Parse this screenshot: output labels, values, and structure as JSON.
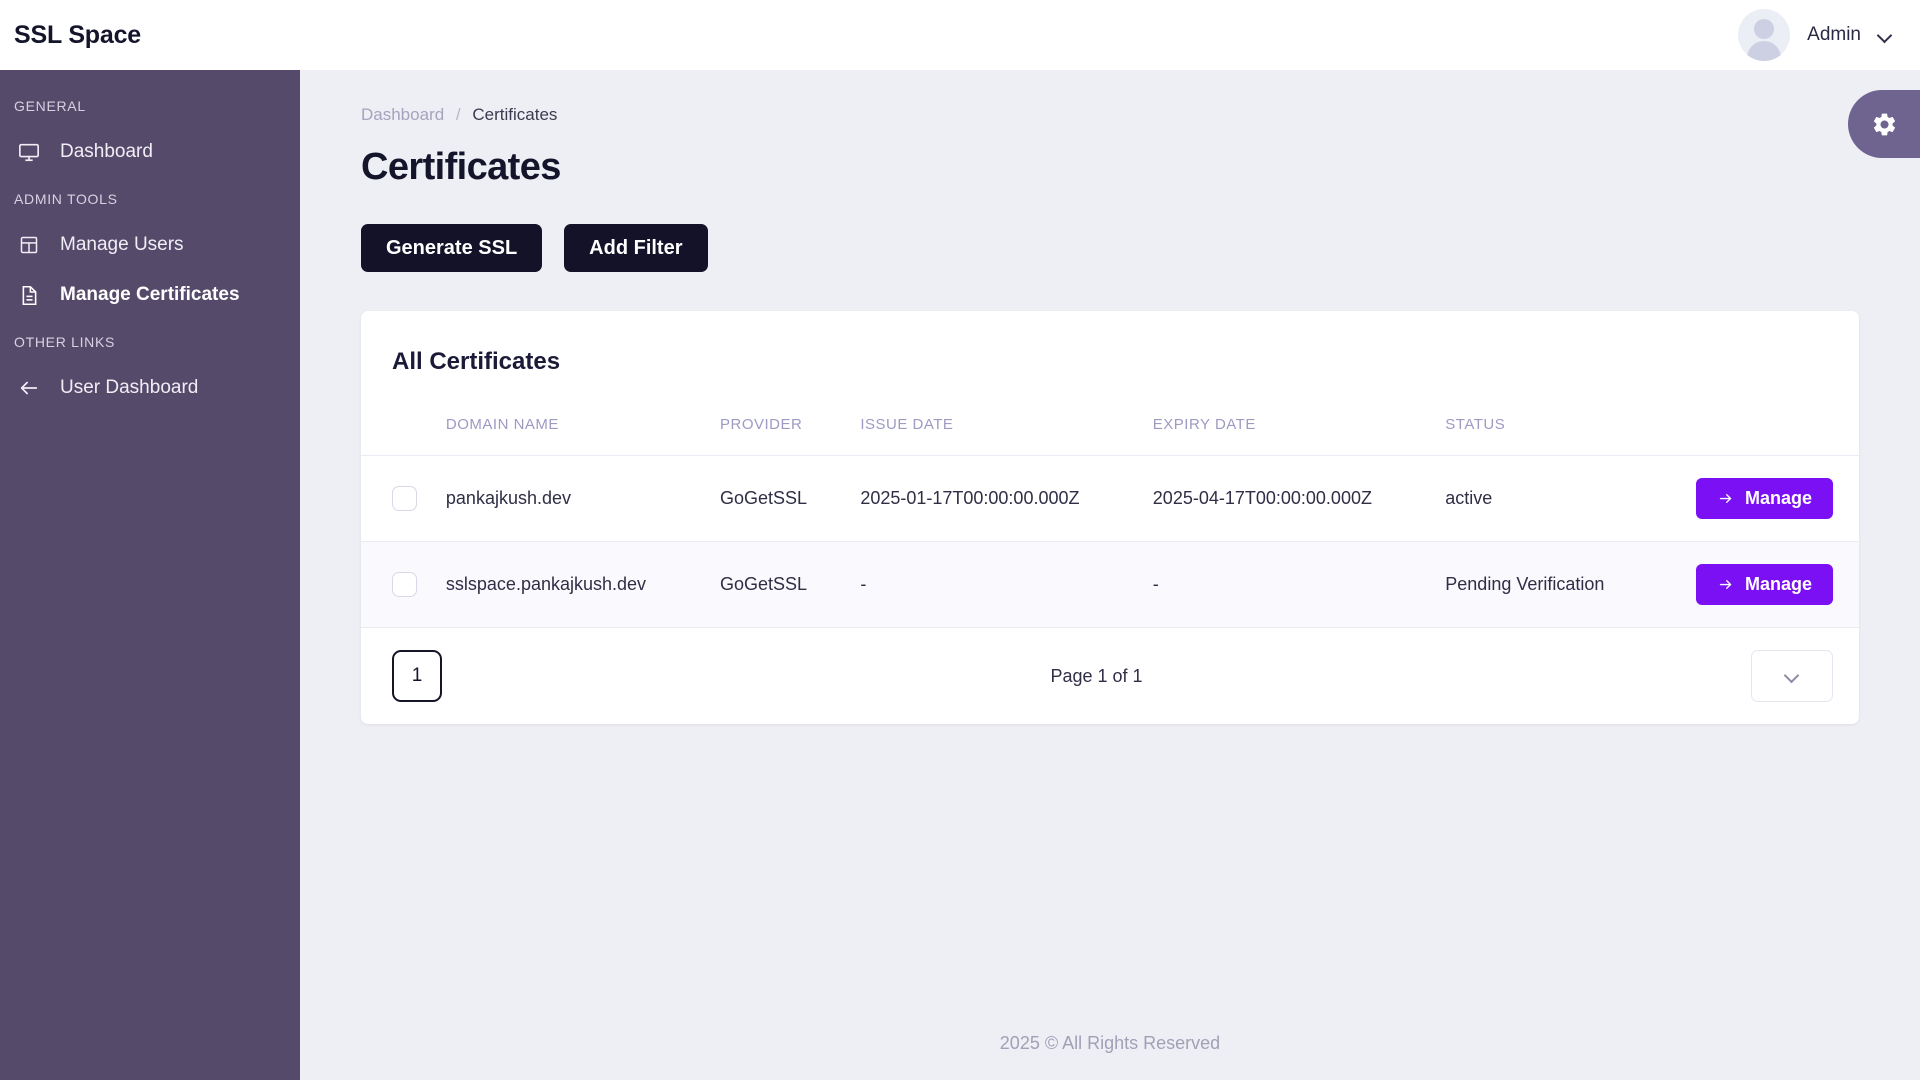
{
  "header": {
    "brand": "SSL Space",
    "user_name": "Admin"
  },
  "sidebar": {
    "sections": [
      {
        "label": "GENERAL",
        "items": [
          {
            "label": "Dashboard",
            "icon": "monitor-icon",
            "active": false
          }
        ]
      },
      {
        "label": "ADMIN TOOLS",
        "items": [
          {
            "label": "Manage Users",
            "icon": "table-icon",
            "active": false
          },
          {
            "label": "Manage Certificates",
            "icon": "document-icon",
            "active": true
          }
        ]
      },
      {
        "label": "OTHER LINKS",
        "items": [
          {
            "label": "User Dashboard",
            "icon": "arrow-left-icon",
            "active": false
          }
        ]
      }
    ]
  },
  "breadcrumb": {
    "parent": "Dashboard",
    "separator": "/",
    "current": "Certificates"
  },
  "page": {
    "title": "Certificates"
  },
  "toolbar": {
    "generate_label": "Generate SSL",
    "filter_label": "Add Filter"
  },
  "table": {
    "card_title": "All Certificates",
    "columns": [
      "DOMAIN NAME",
      "PROVIDER",
      "ISSUE DATE",
      "EXPIRY DATE",
      "STATUS"
    ],
    "action_label": "Manage",
    "rows": [
      {
        "domain": "pankajkush.dev",
        "provider": "GoGetSSL",
        "issue_date": "2025-01-17T00:00:00.000Z",
        "expiry_date": "2025-04-17T00:00:00.000Z",
        "status": "active",
        "action": "Manage"
      },
      {
        "domain": "sslspace.pankajkush.dev",
        "provider": "GoGetSSL",
        "issue_date": "-",
        "expiry_date": "-",
        "status": "Pending Verification",
        "action": "Manage"
      }
    ]
  },
  "pagination": {
    "current_page": "1",
    "page_label": "Page 1 of 1"
  },
  "settings": {
    "icon": "gear-icon"
  },
  "footer": {
    "text": "2025 © All Rights Reserved"
  },
  "colors": {
    "sidebar_bg": "#564a6b",
    "button_dark": "#131229",
    "accent_purple": "#7b10f5",
    "page_bg": "#eeeef5",
    "gear_tab": "#6f6490"
  }
}
